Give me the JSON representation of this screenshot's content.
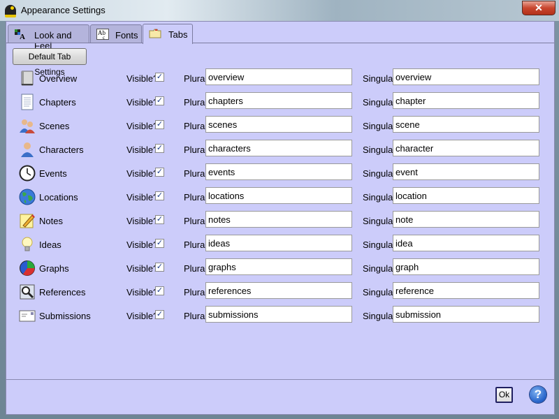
{
  "window": {
    "title": "Appearance Settings",
    "close_glyph": "✕"
  },
  "tabs": [
    {
      "label": "Look and Feel",
      "icon": "look-and-feel-icon"
    },
    {
      "label": "Fonts",
      "icon": "fonts-icon"
    },
    {
      "label": "Tabs",
      "icon": "tabs-icon",
      "active": true
    }
  ],
  "default_button": "Default Tab Settings",
  "labels": {
    "visible": "Visible?",
    "plural": "Plural",
    "singular": "Singular"
  },
  "rows": [
    {
      "name": "Overview",
      "visible": true,
      "plural": "overview",
      "singular": "overview",
      "icon": "book-icon"
    },
    {
      "name": "Chapters",
      "visible": true,
      "plural": "chapters",
      "singular": "chapter",
      "icon": "page-icon"
    },
    {
      "name": "Scenes",
      "visible": true,
      "plural": "scenes",
      "singular": "scene",
      "icon": "people-icon"
    },
    {
      "name": "Characters",
      "visible": true,
      "plural": "characters",
      "singular": "character",
      "icon": "person-icon"
    },
    {
      "name": "Events",
      "visible": true,
      "plural": "events",
      "singular": "event",
      "icon": "clock-icon"
    },
    {
      "name": "Locations",
      "visible": true,
      "plural": "locations",
      "singular": "location",
      "icon": "globe-icon"
    },
    {
      "name": "Notes",
      "visible": true,
      "plural": "notes",
      "singular": "note",
      "icon": "note-pencil-icon"
    },
    {
      "name": "Ideas",
      "visible": true,
      "plural": "ideas",
      "singular": "idea",
      "icon": "lightbulb-icon"
    },
    {
      "name": "Graphs",
      "visible": true,
      "plural": "graphs",
      "singular": "graph",
      "icon": "pie-chart-icon"
    },
    {
      "name": "References",
      "visible": true,
      "plural": "references",
      "singular": "reference",
      "icon": "magnifier-icon"
    },
    {
      "name": "Submissions",
      "visible": true,
      "plural": "submissions",
      "singular": "submission",
      "icon": "envelope-icon"
    }
  ],
  "footer": {
    "ok": "Ok",
    "help": "?"
  },
  "check_glyph": "✓"
}
